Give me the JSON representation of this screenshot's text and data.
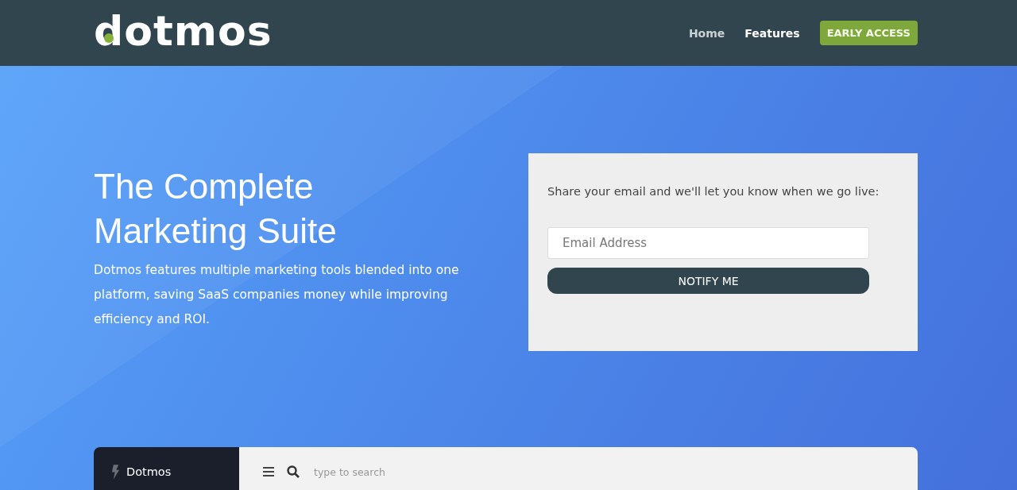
{
  "header": {
    "logo": "dotmos",
    "nav": [
      {
        "label": "Home",
        "selected": false
      },
      {
        "label": "Features",
        "selected": true
      }
    ],
    "cta": "EARLY ACCESS"
  },
  "hero": {
    "title": "The Complete Marketing Suite",
    "text": "Dotmos features multiple marketing tools blended into one platform, saving SaaS companies money while improving efficiency and ROI."
  },
  "signup": {
    "prompt": "Share your email and we'll let you know when we go live:",
    "placeholder": "Email Address",
    "button": "NOTIFY ME"
  },
  "preview": {
    "brand": "Dotmos",
    "search_placeholder": "type to search"
  }
}
